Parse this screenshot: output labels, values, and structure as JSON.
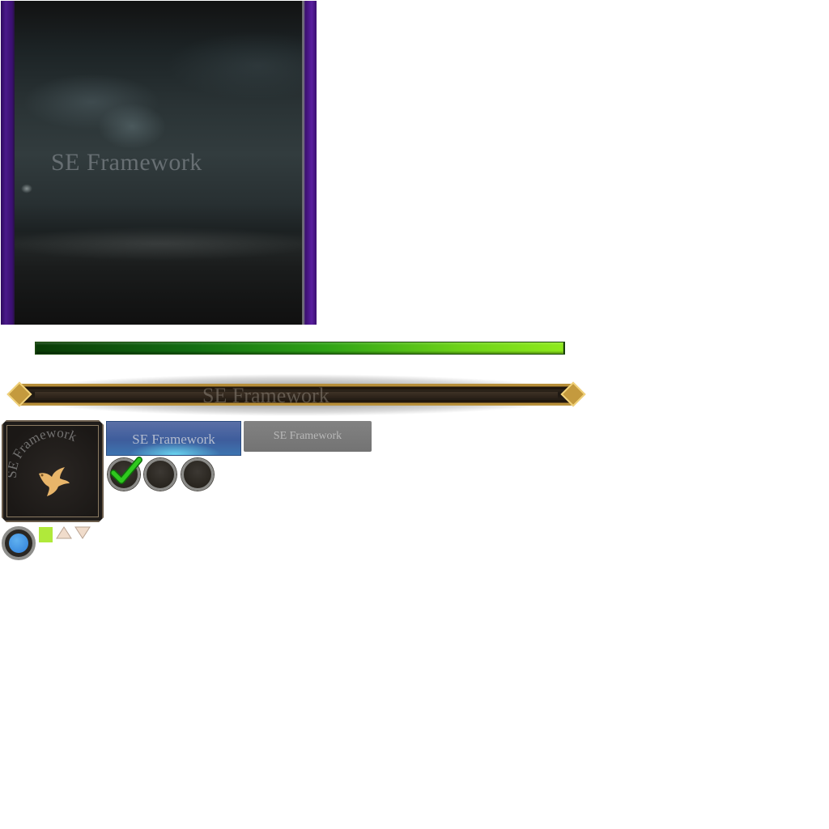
{
  "panel": {
    "watermark": "SE Framework"
  },
  "progress": {
    "fraction": 0.998
  },
  "ornate_bar": {
    "watermark": "SE Framework"
  },
  "dove_tile": {
    "watermark": "SE Framework",
    "icon": "dove-icon"
  },
  "buttons": {
    "blue_label": "SE Framework",
    "gray_label": "SE Framework"
  },
  "round_buttons": [
    {
      "state": "checked",
      "icon": "check-icon"
    },
    {
      "state": "unchecked"
    },
    {
      "state": "unchecked"
    }
  ],
  "radio": {
    "selected": true
  },
  "colors": {
    "panel_border": "#4a1a8a",
    "progress_fill": "#6cd218",
    "gold": "#b78f3a",
    "blue_button": "#3e5d9c",
    "gray_button": "#7b7b7b",
    "check": "#2fc91e",
    "radio_dot": "#3e8ee0",
    "green_square": "#b0e93a",
    "arrow": "#f0dccb"
  }
}
